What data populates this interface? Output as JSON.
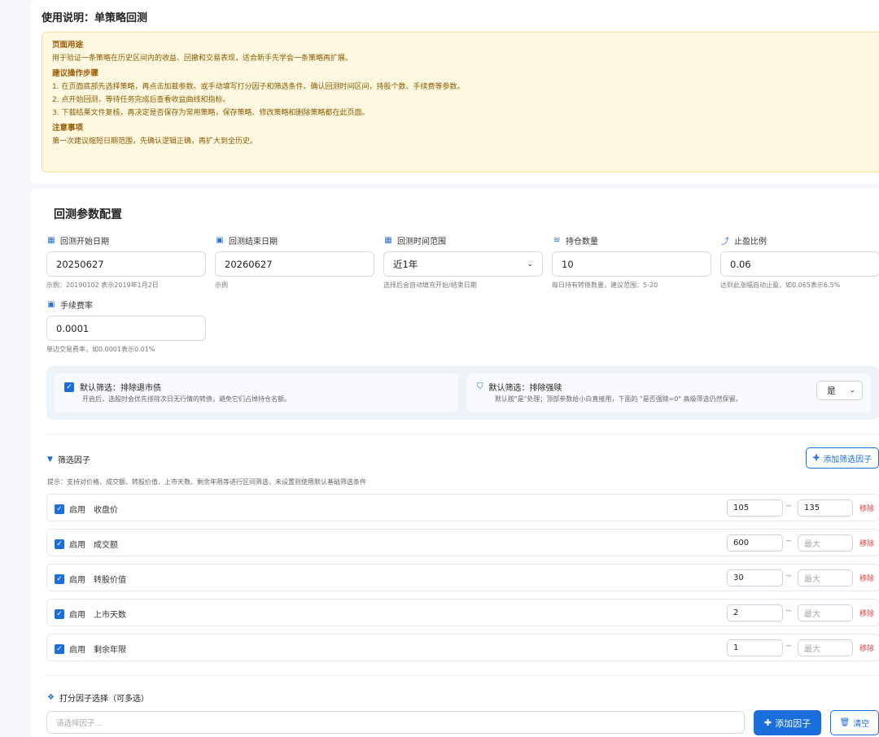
{
  "usage": {
    "title": "使用说明：单策略回测",
    "purpose_heading": "页面用途",
    "purpose_text": "用于验证一条策略在历史区间内的收益、回撤和交易表现，适合新手先学会一条策略再扩展。",
    "steps_heading": "建议操作步骤",
    "steps": [
      "1. 在页面底部先选择策略，再点击加载参数。或手动填写打分因子和筛选条件。确认回测时间区间，持股个数、手续费等参数。",
      "2. 点开始回测，等待任务完成后查看收益曲线和指标。",
      "3. 下载结果文件复核，再决定是否保存为常用策略，保存策略、修改策略和删除策略都在此页面。"
    ],
    "notes_heading": "注意事项",
    "notes_text": "第一次建议缩短日期范围，先确认逻辑正确，再扩大到全历史。"
  },
  "config": {
    "title": "回测参数配置",
    "fields": [
      {
        "label": "回测开始日期",
        "icon": "calendar-icon",
        "value": "20250627",
        "hint": "示例：20190102 表示2019年1月2日"
      },
      {
        "label": "回测结束日期",
        "icon": "calendar-check-icon",
        "value": "20260627",
        "hint": "示例"
      },
      {
        "label": "回测时间范围",
        "icon": "calendar-range-icon",
        "value": "近1年",
        "hint": "选择后会自动填充开始/结束日期"
      },
      {
        "label": "持仓数量",
        "icon": "layers-icon",
        "value": "10",
        "hint": "每日持有转债数量，建议范围：5-20"
      },
      {
        "label": "止盈比例",
        "icon": "chart-line-icon",
        "value": "0.06",
        "hint": "达到此涨幅自动止盈，如0.065表示6.5%"
      },
      {
        "label": "手续费率",
        "icon": "money-icon",
        "value": "0.0001",
        "hint": "单边交易费率，如0.0001表示0.01%"
      }
    ]
  },
  "defaults": {
    "delist": {
      "title": "默认筛选：排除退市债",
      "desc": "开启后，选股时会优先排除次日无行情的转债，避免它们占掉持仓名额。"
    },
    "strong_redeem": {
      "title": "默认筛选：排除强赎",
      "desc": "默认按\"是\"处理；顶部参数给小白直接用，下面的 \"是否强赎=0\" 高级筛选仍然保留。",
      "select_value": "是"
    }
  },
  "filters": {
    "title": "筛选因子",
    "add_label": "添加筛选因子",
    "tip": "提示：支持对价格、成交额、转股价值、上市天数、剩余年限等进行区间筛选，未设置则使用默认基础筛选条件",
    "enable_label": "启用",
    "remove_label": "移除",
    "tilde": "~",
    "max_placeholder": "最大",
    "rows": [
      {
        "name": "收盘价",
        "min": "105",
        "max": "135"
      },
      {
        "name": "成交额",
        "min": "600",
        "max": ""
      },
      {
        "name": "转股价值",
        "min": "30",
        "max": ""
      },
      {
        "name": "上市天数",
        "min": "2",
        "max": ""
      },
      {
        "name": "剩余年限",
        "min": "1",
        "max": ""
      }
    ]
  },
  "scoring": {
    "title": "打分因子选择（可多选）",
    "placeholder": "请选择因子...",
    "add_label": "添加因子",
    "clear_label": "清空"
  }
}
